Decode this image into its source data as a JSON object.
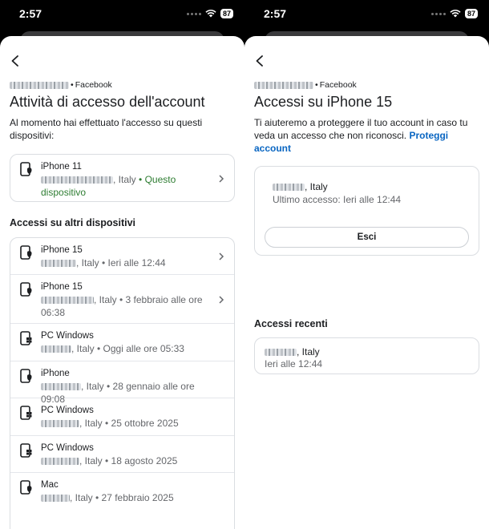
{
  "status": {
    "time": "2:57",
    "battery": "87"
  },
  "left": {
    "breadcrumb_suffix": "Facebook",
    "title": "Attività di accesso dell'account",
    "description": "Al momento hai effettuato l'accesso su questi dispositivi:",
    "current": {
      "device": "iPhone 11",
      "location": ", Italy",
      "tag": "Questo dispositivo"
    },
    "section_title": "Accessi su altri dispositivi",
    "devices": [
      {
        "name": "iPhone 15",
        "meta": ", Italy • Ieri alle 12:44",
        "icon": "phone-icon"
      },
      {
        "name": "iPhone 15",
        "meta": ", Italy • 3 febbraio alle ore 06:38",
        "icon": "phone-icon"
      },
      {
        "name": "PC Windows",
        "meta": ", Italy • Oggi alle ore 05:33",
        "icon": "windows-pc-icon"
      },
      {
        "name": "iPhone",
        "meta": ", Italy • 28 gennaio alle ore 09:08",
        "icon": "phone-icon"
      },
      {
        "name": "PC Windows",
        "meta": ", Italy • 25 ottobre 2025",
        "icon": "windows-pc-icon"
      },
      {
        "name": "PC Windows",
        "meta": ", Italy • 18 agosto 2025",
        "icon": "windows-pc-icon"
      },
      {
        "name": "Mac",
        "meta": ", Italy • 27 febbraio 2025",
        "icon": "mac-icon"
      }
    ]
  },
  "right": {
    "breadcrumb_suffix": "Facebook",
    "title": "Accessi su iPhone 15",
    "description": "Ti aiuteremo a proteggere il tuo account in caso tu veda un accesso che non riconosci.",
    "protect_link": "Proteggi account",
    "location": ", Italy",
    "last_access": "Ultimo accesso: Ieri alle 12:44",
    "logout_button": "Esci",
    "recent_title": "Accessi recenti",
    "recent": {
      "location": ", Italy",
      "time": "Ieri alle 12:44"
    }
  },
  "colors": {
    "link": "#0a66c2",
    "this_device": "#2e7d32",
    "muted": "#65676b"
  }
}
